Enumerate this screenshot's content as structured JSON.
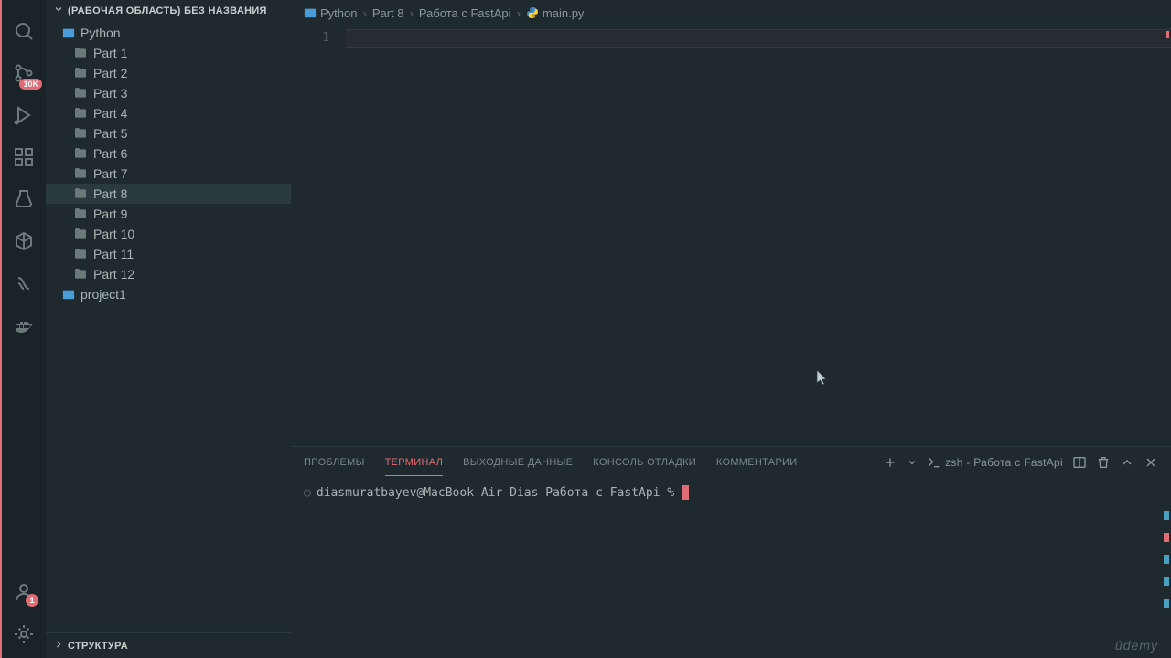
{
  "activity_bar": {
    "source_control_badge": "10K",
    "accounts_badge": "1"
  },
  "sidebar": {
    "workspace_title": "(РАБОЧАЯ ОБЛАСТЬ) БЕЗ НАЗВАНИЯ",
    "root_folder": "Python",
    "folders": [
      "Part 1",
      "Part 2",
      "Part 3",
      "Part 4",
      "Part 5",
      "Part 6",
      "Part 7",
      "Part 8",
      "Part 9",
      "Part 10",
      "Part 11",
      "Part 12"
    ],
    "selected_folder": "Part 8",
    "project": "project1",
    "outline_title": "СТРУКТУРА"
  },
  "breadcrumbs": {
    "items": [
      "Python",
      "Part 8",
      "Работа с FastApi",
      "main.py"
    ]
  },
  "editor": {
    "line_number": "1"
  },
  "panel": {
    "tabs": [
      "ПРОБЛЕМЫ",
      "ТЕРМИНАЛ",
      "ВЫХОДНЫЕ ДАННЫЕ",
      "КОНСОЛЬ ОТЛАДКИ",
      "КОММЕНТАРИИ"
    ],
    "active_tab": "ТЕРМИНАЛ",
    "terminal_label": "zsh - Работа с FastApi",
    "prompt": "diasmuratbayev@MacBook-Air-Dias Работа с FastApi %"
  },
  "watermark": "ûdemy"
}
